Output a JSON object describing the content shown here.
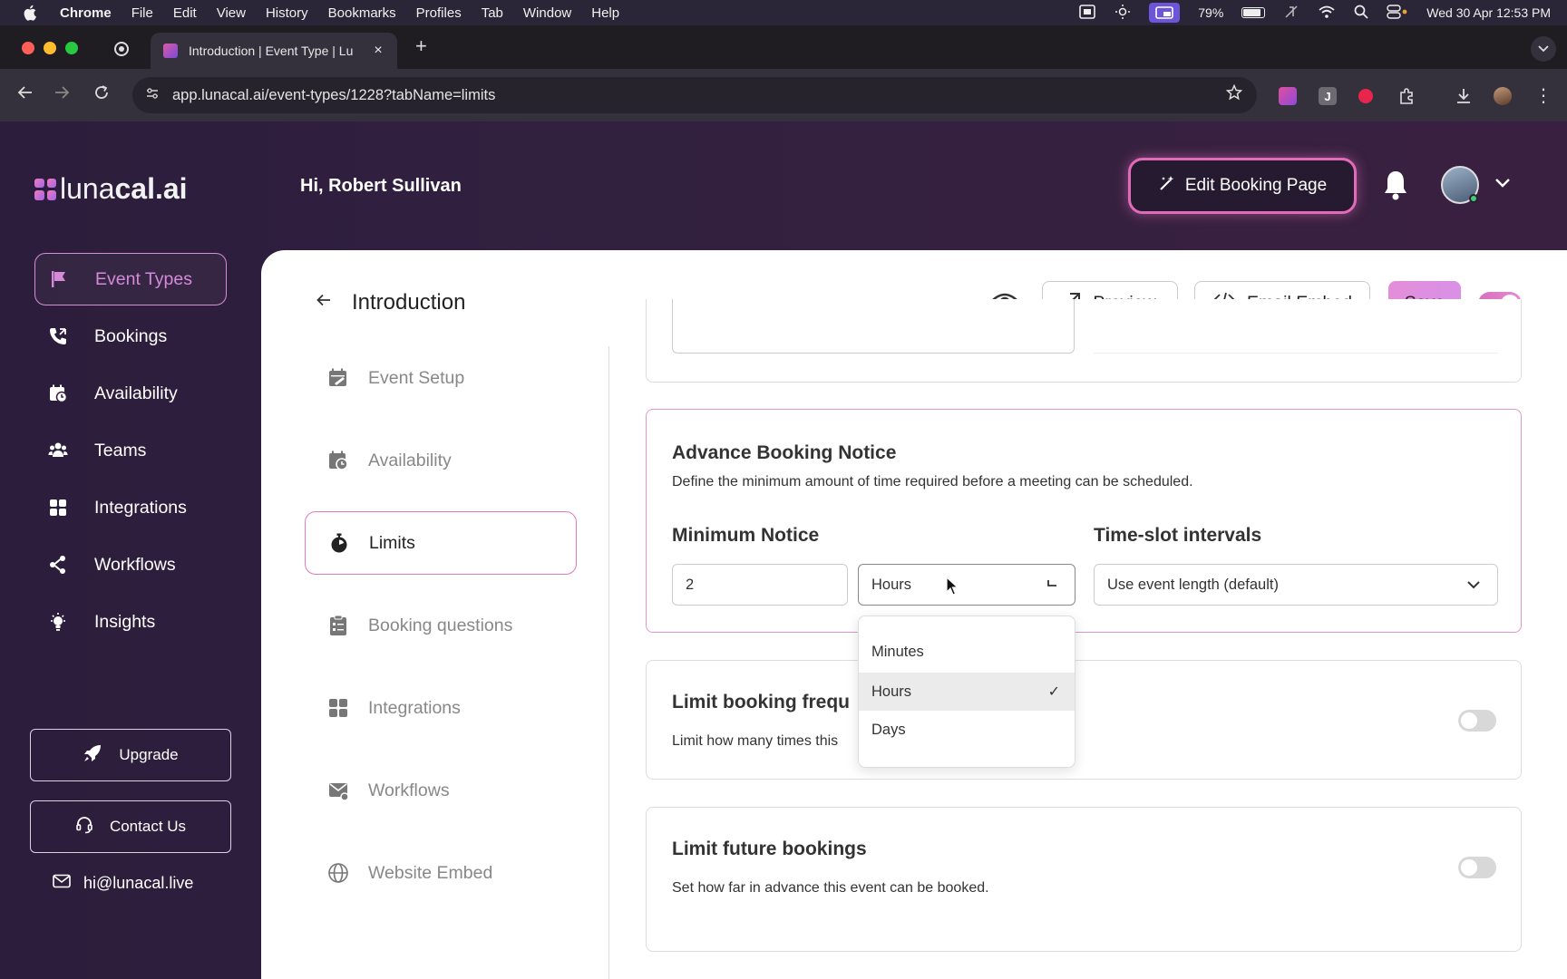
{
  "mac_menubar": {
    "app_name": "Chrome",
    "menus": [
      "File",
      "Edit",
      "View",
      "History",
      "Bookmarks",
      "Profiles",
      "Tab",
      "Window",
      "Help"
    ],
    "battery": "79%",
    "datetime": "Wed 30 Apr  12:53 PM"
  },
  "browser": {
    "tab_title": "Introduction | Event Type | Lu",
    "tab_close": "×",
    "new_tab": "+",
    "url": "app.lunacal.ai/event-types/1228?tabName=limits"
  },
  "header": {
    "logo_light": "luna",
    "logo_bold": "cal.ai",
    "greeting": "Hi, Robert Sullivan",
    "edit_booking_label": "Edit Booking Page"
  },
  "sidebar": {
    "items": [
      {
        "label": "Event Types",
        "icon": "flag-icon"
      },
      {
        "label": "Bookings",
        "icon": "phone-icon"
      },
      {
        "label": "Availability",
        "icon": "calendar-clock-icon"
      },
      {
        "label": "Teams",
        "icon": "users-icon"
      },
      {
        "label": "Integrations",
        "icon": "grid-icon"
      },
      {
        "label": "Workflows",
        "icon": "workflow-icon"
      },
      {
        "label": "Insights",
        "icon": "lightbulb-icon"
      }
    ],
    "upgrade_label": "Upgrade",
    "contact_label": "Contact Us",
    "email": "hi@lunacal.live"
  },
  "page": {
    "title": "Introduction",
    "preview_label": "Preview",
    "email_embed_label": "Email Embed",
    "save_label": "Save"
  },
  "subnav": {
    "items": [
      {
        "label": "Event Setup",
        "icon": "calendar-edit-icon"
      },
      {
        "label": "Availability",
        "icon": "calendar-clock-icon"
      },
      {
        "label": "Limits",
        "icon": "stopwatch-icon"
      },
      {
        "label": "Booking questions",
        "icon": "clipboard-icon"
      },
      {
        "label": "Integrations",
        "icon": "grid-icon"
      },
      {
        "label": "Workflows",
        "icon": "mail-icon"
      },
      {
        "label": "Website Embed",
        "icon": "globe-icon"
      }
    ]
  },
  "advance_notice": {
    "title": "Advance Booking Notice",
    "description": "Define the minimum amount of time required before a meeting can be scheduled.",
    "min_notice_label": "Minimum Notice",
    "min_notice_value": "2",
    "unit_value": "Hours",
    "timeslot_label": "Time-slot intervals",
    "timeslot_value": "Use event length (default)"
  },
  "unit_dropdown": {
    "options": [
      "Minutes",
      "Hours",
      "Days"
    ],
    "selected": "Hours",
    "check": "✓"
  },
  "limit_frequency": {
    "title": "Limit booking frequ",
    "description": "Limit how many times this"
  },
  "limit_future": {
    "title": "Limit future bookings",
    "description": "Set how far in advance this event can be booked."
  }
}
